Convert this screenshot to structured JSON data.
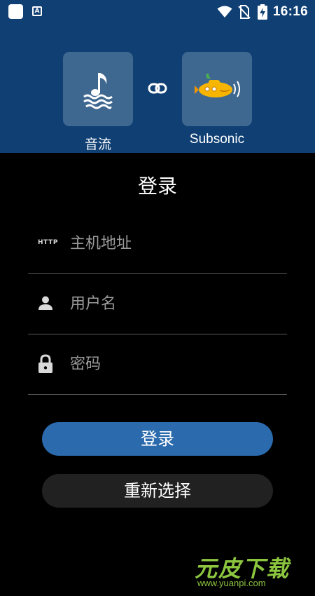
{
  "status_bar": {
    "time": "16:16",
    "font_icon_letter": "A"
  },
  "apps": {
    "left": {
      "label": "音流",
      "icon": "music-note-waves-icon",
      "tile_color": "#3f6891"
    },
    "link_icon": "link-icon",
    "right": {
      "label": "Subsonic",
      "icon": "subsonic-submarine-icon",
      "tile_color": "#3f6891"
    }
  },
  "login": {
    "title": "登录",
    "host": {
      "prefix": "HTTP",
      "placeholder": "主机地址",
      "value": ""
    },
    "username": {
      "icon": "person-icon",
      "placeholder": "用户名",
      "value": ""
    },
    "password": {
      "icon": "lock-icon",
      "placeholder": "密码",
      "value": ""
    },
    "login_button": "登录",
    "reselect_button": "重新选择"
  },
  "watermark": {
    "brand": "元皮下载",
    "url": "www.yuanpi.com"
  },
  "colors": {
    "header": "#0f3f73",
    "primary_button": "#2b6bad",
    "secondary_button": "#212121",
    "background": "#000000"
  }
}
